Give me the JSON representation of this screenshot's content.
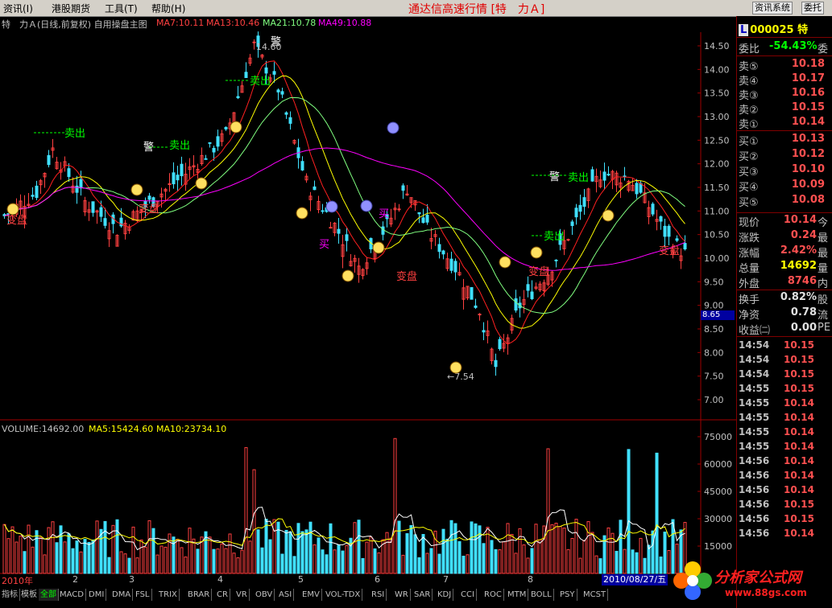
{
  "menu": {
    "items": [
      "资讯(I)",
      "港股期货",
      "工具(T)",
      "帮助(H)"
    ],
    "app_title": "通达信高速行情 [特　力Ａ]",
    "right_buttons": [
      "资讯系统",
      "委托"
    ]
  },
  "indicator_line": {
    "stock": "特　力Ａ(日线,前复权) 自用操盘主图",
    "ma7": "MA7:10.11",
    "ma13": "MA13:10.46",
    "ma21": "MA21:10.78",
    "ma49": "MA49:10.88"
  },
  "volume_line": {
    "volume": "VOLUME:14692.00",
    "ma5": "MA5:15424.60",
    "ma10": "MA10:23734.10"
  },
  "price_axis": [
    "14.50",
    "14.00",
    "13.50",
    "13.00",
    "12.50",
    "12.00",
    "11.50",
    "11.00",
    "10.50",
    "10.00",
    "9.50",
    "9.00",
    "8.50",
    "8.00",
    "7.50",
    "7.00"
  ],
  "price_cursor": "8.65",
  "volume_axis": [
    "75000",
    "60000",
    "45000",
    "30000",
    "15000"
  ],
  "chart_annotations": {
    "high": "14.60",
    "low": "7.54",
    "sell": "卖出",
    "buy": "买",
    "change": "变盘",
    "warn": "警"
  },
  "date_axis": [
    "2010年",
    "2",
    "3",
    "4",
    "5",
    "6",
    "7",
    "8"
  ],
  "date_cursor": "2010/08/27/五",
  "quote": {
    "code": "000025",
    "name": "特",
    "weibi_label": "委比",
    "weibi": "-54.43%",
    "weibi_ext": "委",
    "asks": [
      {
        "label": "卖⑤",
        "price": "10.18"
      },
      {
        "label": "卖④",
        "price": "10.17"
      },
      {
        "label": "卖③",
        "price": "10.16"
      },
      {
        "label": "卖②",
        "price": "10.15"
      },
      {
        "label": "卖①",
        "price": "10.14"
      }
    ],
    "bids": [
      {
        "label": "买①",
        "price": "10.13"
      },
      {
        "label": "买②",
        "price": "10.12"
      },
      {
        "label": "买③",
        "price": "10.10"
      },
      {
        "label": "买④",
        "price": "10.09"
      },
      {
        "label": "买⑤",
        "price": "10.08"
      }
    ],
    "stats": [
      {
        "label": "现价",
        "value": "10.14",
        "ext": "今",
        "color": "#ff5050"
      },
      {
        "label": "涨跌",
        "value": "0.24",
        "ext": "最",
        "color": "#ff5050"
      },
      {
        "label": "涨幅",
        "value": "2.42%",
        "ext": "最",
        "color": "#ff5050"
      },
      {
        "label": "总量",
        "value": "14692",
        "ext": "量",
        "color": "#ffff00"
      },
      {
        "label": "外盘",
        "value": "8746",
        "ext": "内",
        "color": "#ff5050"
      }
    ],
    "stats2": [
      {
        "label": "换手",
        "value": "0.82%",
        "ext": "股",
        "color": "#e0e0e0"
      },
      {
        "label": "净资",
        "value": "0.78",
        "ext": "流",
        "color": "#e0e0e0"
      },
      {
        "label": "收益㈡",
        "value": "0.00",
        "ext": "PE",
        "color": "#e0e0e0"
      }
    ],
    "ticks": [
      {
        "time": "14:54",
        "price": "10.15"
      },
      {
        "time": "14:54",
        "price": "10.15"
      },
      {
        "time": "14:54",
        "price": "10.15"
      },
      {
        "time": "14:55",
        "price": "10.15"
      },
      {
        "time": "14:55",
        "price": "10.14"
      },
      {
        "time": "14:55",
        "price": "10.14"
      },
      {
        "time": "14:55",
        "price": "10.14"
      },
      {
        "time": "14:55",
        "price": "10.14"
      },
      {
        "time": "14:56",
        "price": "10.14"
      },
      {
        "time": "14:56",
        "price": "10.14"
      },
      {
        "time": "14:56",
        "price": "10.14"
      },
      {
        "time": "14:56",
        "price": "10.15"
      },
      {
        "time": "14:56",
        "price": "10.15"
      },
      {
        "time": "14:56",
        "price": "10.14"
      }
    ]
  },
  "tabs": [
    "指标",
    "模板",
    "全部",
    "MACD",
    "DMI",
    "DMA",
    "FSL",
    "TRIX",
    "BRAR",
    "CR",
    "VR",
    "OBV",
    "ASI",
    "EMV",
    "VOL-TDX",
    "RSI",
    "WR",
    "SAR",
    "KDJ",
    "CCI",
    "ROC",
    "MTM",
    "BOLL",
    "PSY",
    "MCST"
  ],
  "logo": {
    "name": "分析家公式网",
    "url": "www.88gs.com"
  },
  "colors": {
    "up": "#ff4040",
    "down": "#40e0ff",
    "ma7": "#ffffff",
    "ma13": "#ffff00",
    "ma21": "#80ff80",
    "ma49": "#ff00ff",
    "red_line": "#ff2020"
  }
}
